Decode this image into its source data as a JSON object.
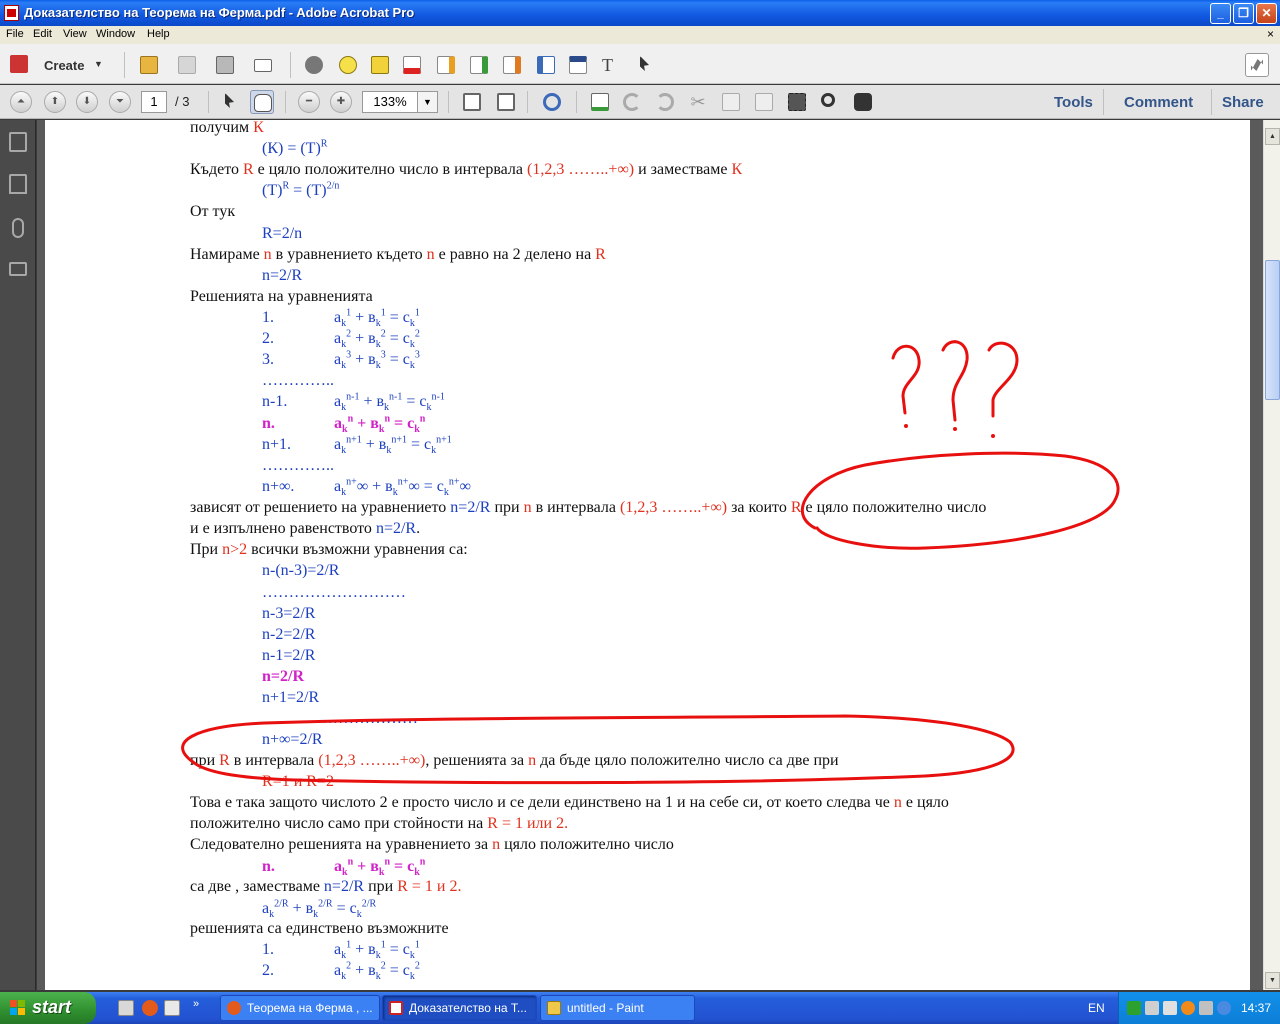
{
  "window": {
    "title": "Доказателство на Теорема на Ферма.pdf - Adobe Acrobat Pro",
    "minimize": "_",
    "maximize": "❐",
    "close": "✕"
  },
  "menu": {
    "items": [
      "File",
      "Edit",
      "View",
      "Window",
      "Help"
    ],
    "close_doc": "×"
  },
  "toolbar1": {
    "create_label": "Create",
    "create_caret": "▼",
    "icons": [
      "open-icon",
      "save-icon",
      "print-icon",
      "email-icon",
      "settings-icon",
      "comment-icon",
      "sign-icon",
      "delete-icon",
      "edit-icon",
      "export-icon",
      "combine-icon",
      "form-icon",
      "select-icon",
      "text-tool-icon",
      "pointer-icon",
      "expand-icon"
    ]
  },
  "toolbar2": {
    "page_current": "1",
    "page_total": "/ 3",
    "zoom": "133%",
    "zoom_caret": "▼",
    "pane_links": [
      "Tools",
      "Comment",
      "Share"
    ]
  },
  "leftnav": {
    "icons": [
      "pages-icon",
      "bookmarks-icon",
      "attachments-icon",
      "signatures-icon"
    ]
  },
  "scrollbar": {
    "up": "▲",
    "down": "▼"
  },
  "doc": {
    "l01": {
      "a": "получим ",
      "b": "К"
    },
    "l02": {
      "a": "(К) = (Т)",
      "sup": "R"
    },
    "l03": {
      "a": "Където ",
      "b": "R",
      "c": " е цяло положително число в интервала ",
      "d": "(1,2,3 ……..+∞)",
      "e": " и заместваме ",
      "f": "К"
    },
    "l04": {
      "a": "(Т)",
      "s1": "R",
      "b": " = (Т)",
      "s2": "2/n"
    },
    "l05": {
      "a": "От тук"
    },
    "l06": {
      "a": "R=2/n"
    },
    "l07": {
      "a": "Намираме ",
      "b": "n",
      "c": " в уравнението където ",
      "d": "n",
      "e": "  е равно на 2 делено на ",
      "f": "R"
    },
    "l08": {
      "a": "n=2/R"
    },
    "l09": {
      "a": "Решенията на уравненията"
    },
    "eq1": {
      "n": "1.",
      "a": "a",
      "s1": "k",
      "p1": "1",
      "b": " + в",
      "s2": "k",
      "p2": "1",
      "c": " = c",
      "s3": "k",
      "p3": "1"
    },
    "eq2": {
      "n": "2.",
      "a": "a",
      "s1": "k",
      "p1": "2",
      "b": " + в",
      "s2": "k",
      "p2": "2",
      "c": " = c",
      "s3": "k",
      "p3": "2"
    },
    "eq3": {
      "n": "3.",
      "a": "a",
      "s1": "k",
      "p1": "3",
      "b": " + в",
      "s2": "k",
      "p2": "3",
      "c": " = c",
      "s3": "k",
      "p3": "3"
    },
    "dots1": "…………..",
    "eq4": {
      "n": "n-1.",
      "a": "a",
      "s1": "k",
      "p1": "n-1",
      "b": " + в",
      "s2": "k",
      "p2": "n-1",
      "c": " = c",
      "s3": "k",
      "p3": "n-1"
    },
    "eq5": {
      "n": "n.",
      "a": "a",
      "s1": "k",
      "p1": "n",
      "b": " + в",
      "s2": "k",
      "p2": "n",
      "c": " = c",
      "s3": "k",
      "p3": "n"
    },
    "eq6": {
      "n": "n+1.",
      "a": "a",
      "s1": "k",
      "p1": "n+1",
      "b": " + в",
      "s2": "k",
      "p2": "n+1",
      "c": " = c",
      "s3": "k",
      "p3": "n+1"
    },
    "dots2": "…………..",
    "eq7": {
      "n": "n+∞.",
      "a": "a",
      "s1": "k",
      "p1": "n+",
      "b": "∞ + в",
      "s2": "k",
      "p2": "n+",
      "c": "∞ = c",
      "s3": "k",
      "p3": "n+",
      "d": "∞"
    },
    "l10": {
      "a": "зависят от решението на уравнението ",
      "b": "n=2/R",
      "c": " при ",
      "d": "n",
      "e": " в интервала ",
      "f": "(1,2,3 ……..+∞)",
      "g": " за които ",
      "h": "R",
      "i": " е цяло положително число"
    },
    "l11": {
      "a": "и е изпълнено равенството ",
      "b": "n=2/R",
      "c": "."
    },
    "l12": {
      "a": "При ",
      "b": "n>2",
      "c": " всички възможни уравнения са:"
    },
    "s1": "n-(n-3)=2/R",
    "sdots1": "………………………",
    "s2": "n-3=2/R",
    "s3": "n-2=2/R",
    "s4": "n-1=2/R",
    "s5": "n=2/R",
    "s6": "n+1=2/R",
    "sdots2": "……………………",
    "s7": "n+∞=2/R",
    "l13": {
      "a": "при ",
      "b": "R",
      "c": " в интервала ",
      "d": "(1,2,3 ……..+∞)",
      "e": ", решенията за ",
      "f": "n",
      "g": " да бъде цяло положително число са две при"
    },
    "l14": {
      "a": "R=1 и R=2"
    },
    "l15": {
      "a": "Това е така защото числото 2 е просто число и се дели единствено на 1 и на себе си, от което следва че ",
      "b": "n",
      "c": " е цяло"
    },
    "l16": {
      "a": "положително число само при стойности на ",
      "b": "R = 1 или 2."
    },
    "l17": {
      "a": "Следователно решенията на уравнението за ",
      "b": "n",
      "c": " цяло положително число"
    },
    "eq8": {
      "n": "n.",
      "a": "a",
      "s1": "k",
      "p1": "n",
      "b": " + в",
      "s2": "k",
      "p2": "n",
      "c": " = c",
      "s3": "k",
      "p3": "n"
    },
    "l18": {
      "a": "са две , заместваме ",
      "b": "n=2/R",
      "c": " при ",
      "d": "R = 1 и 2."
    },
    "eq9": {
      "a": "a",
      "s1": "k",
      "p1": "2/R",
      "b": " + в",
      "s2": "k",
      "p2": "2/R",
      "c": " = c",
      "s3": "k",
      "p3": "2/R"
    },
    "l19": {
      "a": "решенията са единствено възможните"
    },
    "eq10": {
      "n": "1.",
      "a": "a",
      "s1": "k",
      "p1": "1",
      "b": " + в",
      "s2": "k",
      "p2": "1",
      "c": " = c",
      "s3": "k",
      "p3": "1"
    },
    "eq11": {
      "n": "2.",
      "a": "a",
      "s1": "k",
      "p1": "2",
      "b": " + в",
      "s2": "k",
      "p2": "2",
      "c": " = c",
      "s3": "k",
      "p3": "2"
    }
  },
  "annotation": {
    "color": "#e8100e",
    "question_marks": "???"
  },
  "taskbar": {
    "start_label": "start",
    "more": "»",
    "tasks": [
      {
        "label": "Теорема на Ферма , ...",
        "icon": "firefox-icon"
      },
      {
        "label": "Доказателство на Т...",
        "icon": "acrobat-icon"
      },
      {
        "label": "untitled - Paint",
        "icon": "paint-icon"
      }
    ],
    "language": "EN",
    "clock": "14:37"
  },
  "colors": {
    "red_text": "#e0301e",
    "blue_text": "#1c3fbf",
    "magenta_text": "#d023c8",
    "pane_link": "#33558a"
  }
}
